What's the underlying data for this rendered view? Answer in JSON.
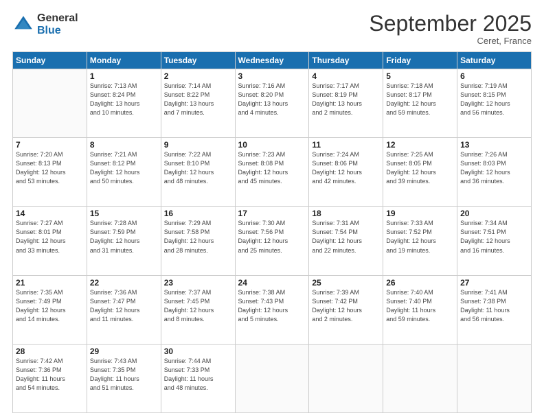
{
  "header": {
    "logo_general": "General",
    "logo_blue": "Blue",
    "month_title": "September 2025",
    "location": "Ceret, France"
  },
  "days_of_week": [
    "Sunday",
    "Monday",
    "Tuesday",
    "Wednesday",
    "Thursday",
    "Friday",
    "Saturday"
  ],
  "weeks": [
    [
      {
        "day": "",
        "info": ""
      },
      {
        "day": "1",
        "info": "Sunrise: 7:13 AM\nSunset: 8:24 PM\nDaylight: 13 hours\nand 10 minutes."
      },
      {
        "day": "2",
        "info": "Sunrise: 7:14 AM\nSunset: 8:22 PM\nDaylight: 13 hours\nand 7 minutes."
      },
      {
        "day": "3",
        "info": "Sunrise: 7:16 AM\nSunset: 8:20 PM\nDaylight: 13 hours\nand 4 minutes."
      },
      {
        "day": "4",
        "info": "Sunrise: 7:17 AM\nSunset: 8:19 PM\nDaylight: 13 hours\nand 2 minutes."
      },
      {
        "day": "5",
        "info": "Sunrise: 7:18 AM\nSunset: 8:17 PM\nDaylight: 12 hours\nand 59 minutes."
      },
      {
        "day": "6",
        "info": "Sunrise: 7:19 AM\nSunset: 8:15 PM\nDaylight: 12 hours\nand 56 minutes."
      }
    ],
    [
      {
        "day": "7",
        "info": "Sunrise: 7:20 AM\nSunset: 8:13 PM\nDaylight: 12 hours\nand 53 minutes."
      },
      {
        "day": "8",
        "info": "Sunrise: 7:21 AM\nSunset: 8:12 PM\nDaylight: 12 hours\nand 50 minutes."
      },
      {
        "day": "9",
        "info": "Sunrise: 7:22 AM\nSunset: 8:10 PM\nDaylight: 12 hours\nand 48 minutes."
      },
      {
        "day": "10",
        "info": "Sunrise: 7:23 AM\nSunset: 8:08 PM\nDaylight: 12 hours\nand 45 minutes."
      },
      {
        "day": "11",
        "info": "Sunrise: 7:24 AM\nSunset: 8:06 PM\nDaylight: 12 hours\nand 42 minutes."
      },
      {
        "day": "12",
        "info": "Sunrise: 7:25 AM\nSunset: 8:05 PM\nDaylight: 12 hours\nand 39 minutes."
      },
      {
        "day": "13",
        "info": "Sunrise: 7:26 AM\nSunset: 8:03 PM\nDaylight: 12 hours\nand 36 minutes."
      }
    ],
    [
      {
        "day": "14",
        "info": "Sunrise: 7:27 AM\nSunset: 8:01 PM\nDaylight: 12 hours\nand 33 minutes."
      },
      {
        "day": "15",
        "info": "Sunrise: 7:28 AM\nSunset: 7:59 PM\nDaylight: 12 hours\nand 31 minutes."
      },
      {
        "day": "16",
        "info": "Sunrise: 7:29 AM\nSunset: 7:58 PM\nDaylight: 12 hours\nand 28 minutes."
      },
      {
        "day": "17",
        "info": "Sunrise: 7:30 AM\nSunset: 7:56 PM\nDaylight: 12 hours\nand 25 minutes."
      },
      {
        "day": "18",
        "info": "Sunrise: 7:31 AM\nSunset: 7:54 PM\nDaylight: 12 hours\nand 22 minutes."
      },
      {
        "day": "19",
        "info": "Sunrise: 7:33 AM\nSunset: 7:52 PM\nDaylight: 12 hours\nand 19 minutes."
      },
      {
        "day": "20",
        "info": "Sunrise: 7:34 AM\nSunset: 7:51 PM\nDaylight: 12 hours\nand 16 minutes."
      }
    ],
    [
      {
        "day": "21",
        "info": "Sunrise: 7:35 AM\nSunset: 7:49 PM\nDaylight: 12 hours\nand 14 minutes."
      },
      {
        "day": "22",
        "info": "Sunrise: 7:36 AM\nSunset: 7:47 PM\nDaylight: 12 hours\nand 11 minutes."
      },
      {
        "day": "23",
        "info": "Sunrise: 7:37 AM\nSunset: 7:45 PM\nDaylight: 12 hours\nand 8 minutes."
      },
      {
        "day": "24",
        "info": "Sunrise: 7:38 AM\nSunset: 7:43 PM\nDaylight: 12 hours\nand 5 minutes."
      },
      {
        "day": "25",
        "info": "Sunrise: 7:39 AM\nSunset: 7:42 PM\nDaylight: 12 hours\nand 2 minutes."
      },
      {
        "day": "26",
        "info": "Sunrise: 7:40 AM\nSunset: 7:40 PM\nDaylight: 11 hours\nand 59 minutes."
      },
      {
        "day": "27",
        "info": "Sunrise: 7:41 AM\nSunset: 7:38 PM\nDaylight: 11 hours\nand 56 minutes."
      }
    ],
    [
      {
        "day": "28",
        "info": "Sunrise: 7:42 AM\nSunset: 7:36 PM\nDaylight: 11 hours\nand 54 minutes."
      },
      {
        "day": "29",
        "info": "Sunrise: 7:43 AM\nSunset: 7:35 PM\nDaylight: 11 hours\nand 51 minutes."
      },
      {
        "day": "30",
        "info": "Sunrise: 7:44 AM\nSunset: 7:33 PM\nDaylight: 11 hours\nand 48 minutes."
      },
      {
        "day": "",
        "info": ""
      },
      {
        "day": "",
        "info": ""
      },
      {
        "day": "",
        "info": ""
      },
      {
        "day": "",
        "info": ""
      }
    ]
  ]
}
